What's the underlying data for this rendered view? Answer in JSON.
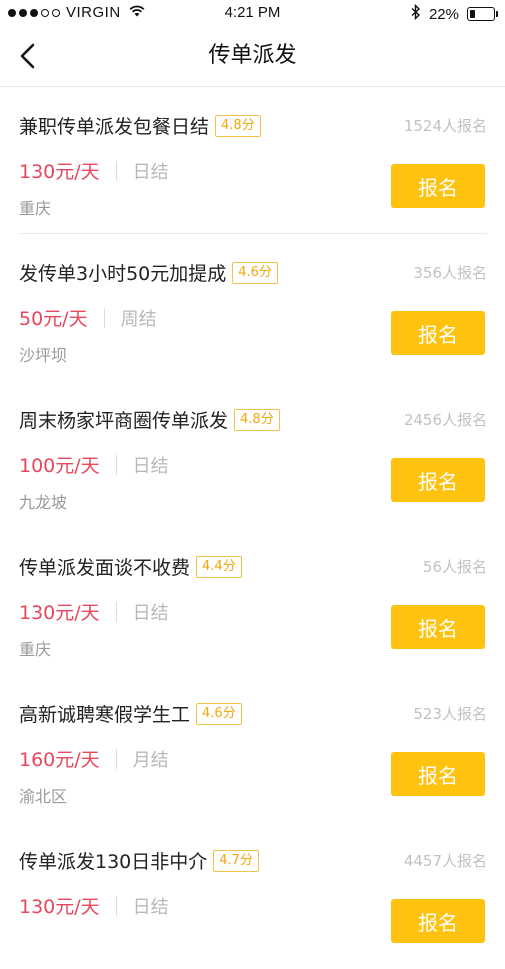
{
  "status_bar": {
    "carrier": "VIRGIN",
    "signal_dots_filled": 3,
    "signal_dots_total": 5,
    "time": "4:21 PM",
    "battery_text": "22%",
    "battery_level": 0.22
  },
  "nav": {
    "title": "传单派发",
    "back_icon": "chevron-left-icon"
  },
  "jobs": [
    {
      "title": "兼职传单派发包餐日结",
      "rating": "4.8分",
      "applicants": "1524人报名",
      "pay": "130元/天",
      "settlement": "日结",
      "location": "重庆",
      "apply_label": "报名"
    },
    {
      "title": "发传单3小时50元加提成",
      "rating": "4.6分",
      "applicants": "356人报名",
      "pay": "50元/天",
      "settlement": "周结",
      "location": "沙坪坝",
      "apply_label": "报名"
    },
    {
      "title": "周末杨家坪商圈传单派发",
      "rating": "4.8分",
      "applicants": "2456人报名",
      "pay": "100元/天",
      "settlement": "日结",
      "location": "九龙坡",
      "apply_label": "报名"
    },
    {
      "title": "传单派发面谈不收费",
      "rating": "4.4分",
      "applicants": "56人报名",
      "pay": "130元/天",
      "settlement": "日结",
      "location": "重庆",
      "apply_label": "报名"
    },
    {
      "title": "高新诚聘寒假学生工",
      "rating": "4.6分",
      "applicants": "523人报名",
      "pay": "160元/天",
      "settlement": "月结",
      "location": "渝北区",
      "apply_label": "报名"
    },
    {
      "title": "传单派发130日非中介",
      "rating": "4.7分",
      "applicants": "4457人报名",
      "pay": "130元/天",
      "settlement": "日结",
      "location": "",
      "apply_label": "报名"
    }
  ],
  "colors": {
    "accent": "#ffc20e",
    "price": "#e8475c",
    "rating": "#f0a80c"
  }
}
